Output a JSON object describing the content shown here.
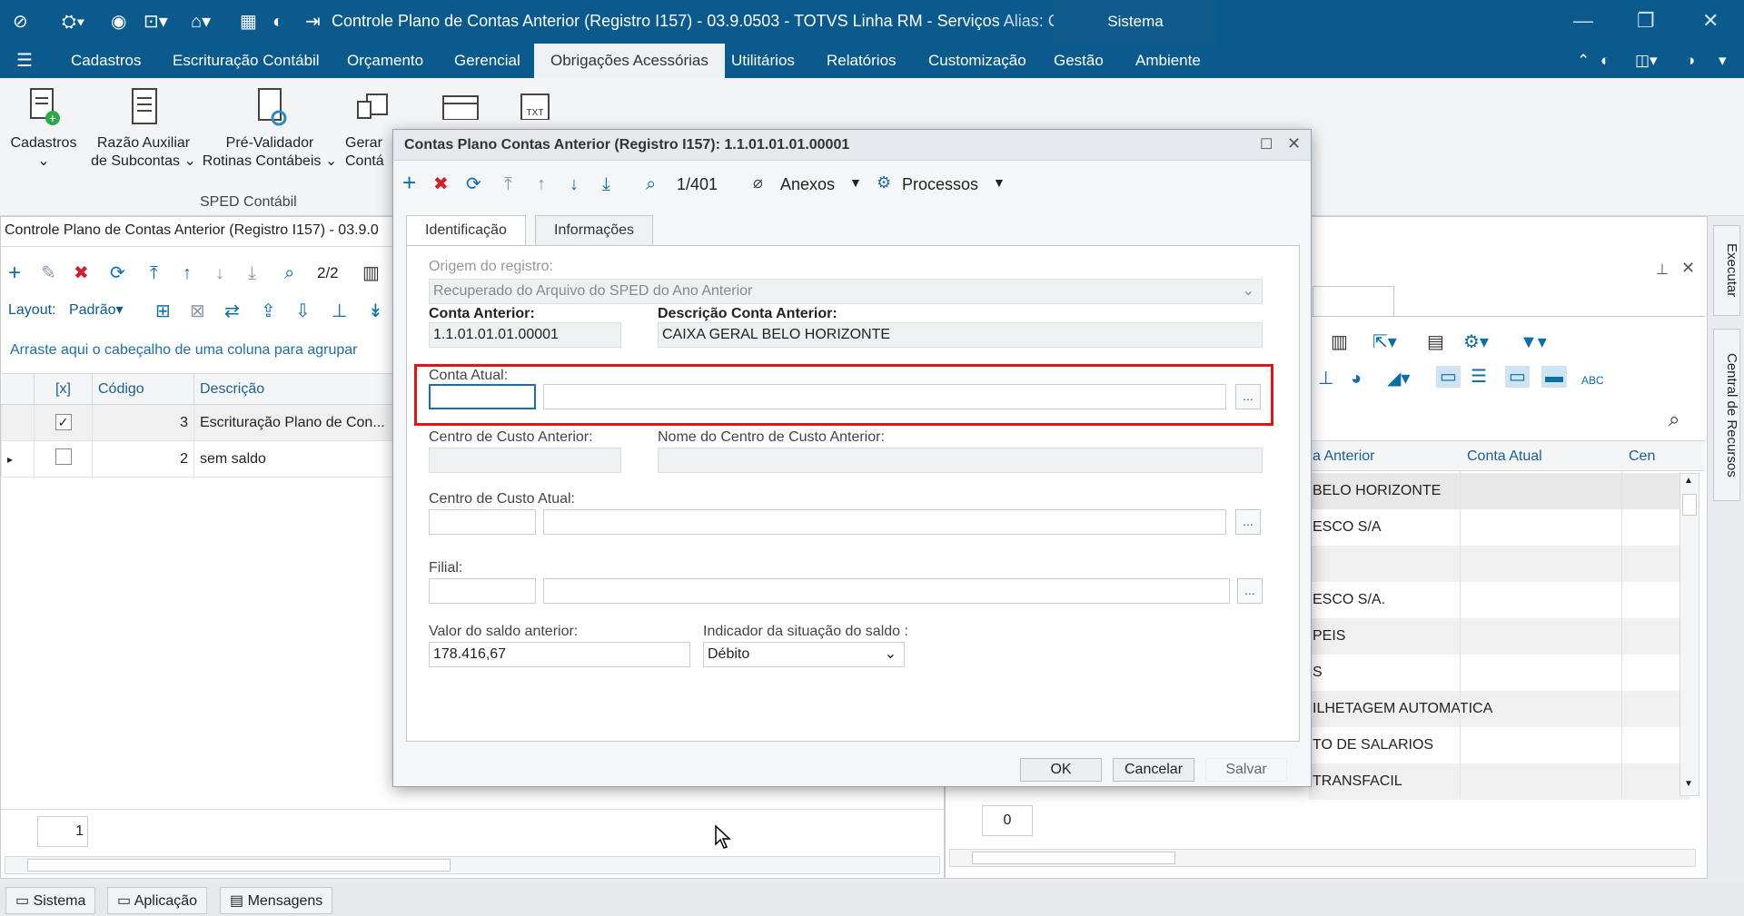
{
  "window": {
    "title": "Controle Plano de Contas Anterior (Registro I157) - 03.9.0503 - TOTVS Linha RM - Serviços",
    "alias": "Alias: Corpor...",
    "sistema_tab": "Sistema"
  },
  "menu": {
    "items": [
      "Cadastros",
      "Escrituração Contábil",
      "Orçamento",
      "Gerencial",
      "Obrigações Acessórias",
      "Utilitários",
      "Relatórios",
      "Customização",
      "Gestão",
      "Ambiente"
    ],
    "active": "Obrigações Acessórias"
  },
  "ribbon": {
    "buttons": [
      {
        "line1": "Cadastros",
        "line2": ""
      },
      {
        "line1": "Razão Auxiliar",
        "line2": "de Subcontas"
      },
      {
        "line1": "Pré-Validador",
        "line2": "Rotinas Contábeis"
      },
      {
        "line1": "Gerar",
        "line2": "Contá"
      }
    ],
    "group_label": "SPED Contábil"
  },
  "left_panel": {
    "title": "Controle Plano de Contas Anterior (Registro I157) - 03.9.0",
    "record_counter": "2/2",
    "layout_label": "Layout:",
    "layout_value": "Padrão",
    "group_hint": "Arraste aqui o cabeçalho de uma coluna para agrupar",
    "columns": [
      "[x]",
      "Código",
      "Descrição"
    ],
    "rows": [
      {
        "checked": true,
        "codigo": "3",
        "descricao": "Escrituração Plano de Con..."
      },
      {
        "checked": false,
        "codigo": "2",
        "descricao": "sem saldo"
      }
    ],
    "page_number": "1"
  },
  "right_panel": {
    "columns": [
      "a Anterior",
      "Conta Atual",
      "Cen"
    ],
    "rows": [
      "BELO HORIZONTE",
      "ESCO S/A",
      "",
      "ESCO S/A.",
      "PEIS",
      "S",
      "ILHETAGEM AUTOMATICA",
      "TO DE SALARIOS",
      "TRANSFACIL"
    ],
    "page_number": "0"
  },
  "status_bar": {
    "tabs": [
      "Sistema",
      "Aplicação",
      "Mensagens"
    ]
  },
  "side_tabs": [
    "Executar",
    "Central de Recursos"
  ],
  "dialog": {
    "title": "Contas Plano Contas Anterior (Registro I157): 1.1.01.01.01.00001",
    "record_counter": "1/401",
    "anexos_label": "Anexos",
    "processos_label": "Processos",
    "tabs": [
      "Identificação",
      "Informações"
    ],
    "active_tab": "Identificação",
    "fields": {
      "origem_label": "Origem do registro:",
      "origem_value": "Recuperado do Arquivo do SPED do Ano Anterior",
      "conta_anterior_label": "Conta Anterior:",
      "conta_anterior_value": "1.1.01.01.01.00001",
      "descricao_conta_anterior_label": "Descrição Conta Anterior:",
      "descricao_conta_anterior_value": "CAIXA GERAL BELO HORIZONTE",
      "conta_atual_label": "Conta Atual:",
      "conta_atual_value": "",
      "centro_custo_anterior_label": "Centro de Custo Anterior:",
      "centro_custo_anterior_value": "",
      "nome_centro_custo_anterior_label": "Nome do Centro de Custo Anterior:",
      "nome_centro_custo_anterior_value": "",
      "centro_custo_atual_label": "Centro de Custo Atual:",
      "filial_label": "Filial:",
      "valor_saldo_label": "Valor do saldo anterior:",
      "valor_saldo_value": "178.416,67",
      "indicador_label": "Indicador da situação do saldo :",
      "indicador_value": "Débito"
    },
    "buttons": {
      "ok": "OK",
      "cancel": "Cancelar",
      "save": "Salvar"
    },
    "ellipsis": "..."
  },
  "colors": {
    "title_bar": "#0a5a8e",
    "highlight": "#e01515",
    "link": "#1a6eb0"
  }
}
